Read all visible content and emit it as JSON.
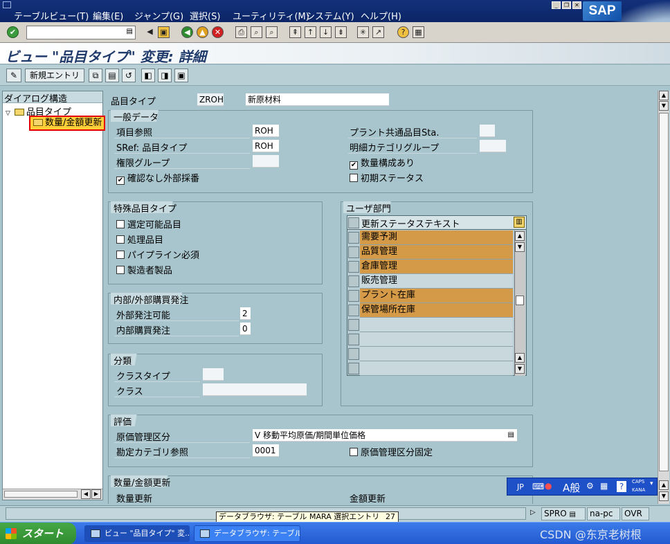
{
  "menu": {
    "items": [
      "テーブルビュー(T)",
      "編集(E)",
      "ジャンプ(G)",
      "選択(S)",
      "ユーティリティ(M)",
      "システム(Y)",
      "ヘルプ(H)"
    ],
    "logo": "SAP"
  },
  "header": {
    "title": "ビュー \"品目タイプ\" 変更: 詳細"
  },
  "app_toolbar": {
    "new_entry_label": "新規エントリ"
  },
  "tree": {
    "header": "ダイアログ構造",
    "root": "品目タイプ",
    "child": "数量/金額更新"
  },
  "material_type": {
    "label": "品目タイプ",
    "code": "ZROH",
    "description": "新原材料"
  },
  "general": {
    "title": "一般データ",
    "field_ref_label": "項目参照",
    "field_ref_value": "ROH",
    "sref_label": "SRef: 品目タイプ",
    "sref_value": "ROH",
    "auth_group_label": "権限グループ",
    "ext_numbering_label": "確認なし外部採番",
    "ext_numbering_checked": true,
    "plant_status_label": "プラント共通品目Sta.",
    "item_cat_group_label": "明細カテゴリグループ",
    "with_bom_label": "数量構成あり",
    "with_bom_checked": true,
    "initial_status_label": "初期ステータス",
    "initial_status_checked": false
  },
  "special": {
    "title": "特殊品目タイプ",
    "items": [
      "選定可能品目",
      "処理品目",
      "パイプライン必須",
      "製造者製品"
    ]
  },
  "purchasing": {
    "title": "内部/外部購買発注",
    "external_label": "外部発注可能",
    "external_value": "2",
    "internal_label": "内部購買発注",
    "internal_value": "0"
  },
  "classification": {
    "title": "分類",
    "class_type_label": "クラスタイプ",
    "class_label": "クラス"
  },
  "user_departments": {
    "title": "ユーザ部門",
    "column_header": "更新ステータステキスト",
    "rows": [
      {
        "text": "需要予測",
        "highlight": true
      },
      {
        "text": "品質管理",
        "highlight": true
      },
      {
        "text": "倉庫管理",
        "highlight": true
      },
      {
        "text": "販売管理",
        "highlight": false
      },
      {
        "text": "プラント在庫",
        "highlight": true
      },
      {
        "text": "保管場所在庫",
        "highlight": true
      },
      {
        "text": "",
        "highlight": false
      },
      {
        "text": "",
        "highlight": false
      },
      {
        "text": "",
        "highlight": false
      },
      {
        "text": "",
        "highlight": false
      }
    ]
  },
  "valuation": {
    "title": "評価",
    "price_control_label": "原価管理区分",
    "price_control_value": "V 移動平均原価/期間単位価格",
    "acct_cat_label": "勘定カテゴリ参照",
    "acct_cat_value": "0001",
    "price_control_fixed_label": "原価管理区分固定",
    "price_control_fixed_checked": false
  },
  "qty_value": {
    "title": "数量/金額更新",
    "qty_label": "数量更新",
    "value_label": "金額更新"
  },
  "status": {
    "tooltip": "データブラウザ: テーブル MARA 選択エントリ",
    "tooltip_count": "27",
    "tcode": "SPRO",
    "server": "na-pc",
    "mode": "OVR"
  },
  "ime": {
    "lang": "JP",
    "mode": "A般",
    "caps": "CAPS",
    "kana": "KANA"
  },
  "taskbar": {
    "start": "スタート",
    "task1": "ビュー \"品目タイプ\" 変...",
    "task2": "データブラウザ: テーブル...",
    "watermark": "CSDN @东京老树根"
  }
}
